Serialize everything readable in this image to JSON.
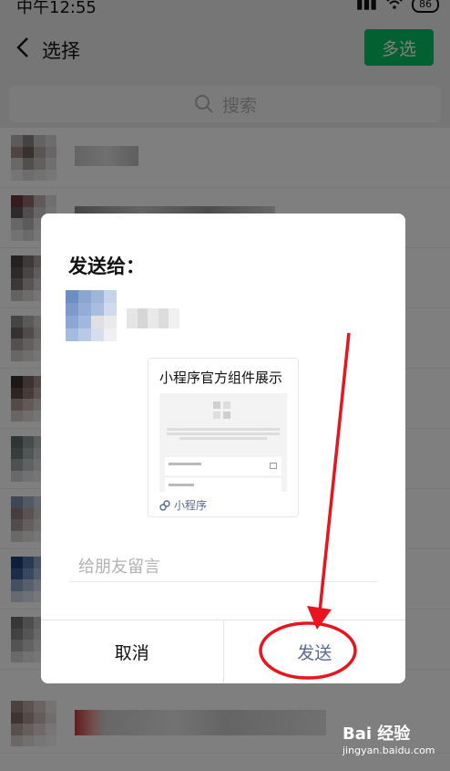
{
  "status_bar": {
    "time": "中午12:55",
    "battery": "86"
  },
  "header": {
    "title": "选择",
    "multi_select_label": "多选"
  },
  "search": {
    "placeholder": "搜索"
  },
  "dialog": {
    "title": "发送给：",
    "card": {
      "title": "小程序官方组件展示",
      "footer_label": "小程序"
    },
    "message_placeholder": "给朋友留言",
    "cancel_label": "取消",
    "send_label": "发送"
  },
  "watermark": {
    "logo": "Bai 经验",
    "url": "jingyan.baidu.com"
  },
  "colors": {
    "primary_green": "#07c160",
    "link_blue": "#576b95",
    "annotation_red": "#e8141e"
  },
  "icons": [
    "back-arrow-icon",
    "search-icon",
    "wifi-icon",
    "signal-icon",
    "mini-program-icon"
  ]
}
